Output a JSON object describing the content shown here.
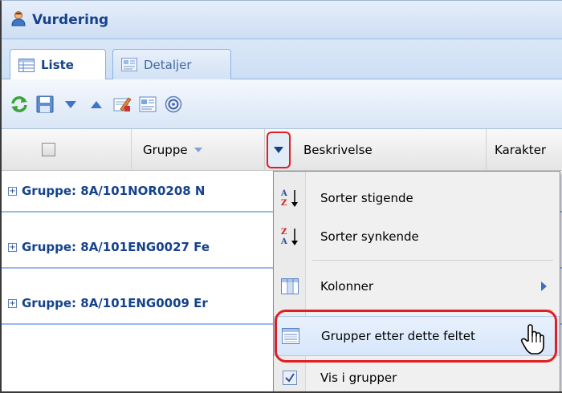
{
  "window": {
    "title": "Vurdering",
    "title_icon": "users-icon"
  },
  "tabs": [
    {
      "label": "Liste",
      "icon": "list-icon",
      "active": true
    },
    {
      "label": "Detaljer",
      "icon": "details-icon",
      "active": false
    }
  ],
  "toolbar": {
    "buttons": [
      "refresh-icon",
      "save-icon",
      "move-down-icon",
      "move-up-icon",
      "edit-icon",
      "layout-icon",
      "help-icon"
    ]
  },
  "grid": {
    "columns": [
      "Gruppe",
      "Beskrivelse",
      "Karakter"
    ],
    "groups": [
      "Gruppe: 8A/101NOR0208 N",
      "Gruppe: 8A/101ENG0027 Fe",
      "Gruppe: 8A/101ENG0009 Er"
    ]
  },
  "menu": {
    "items": [
      {
        "label": "Sorter stigende",
        "icon": "sort-asc-icon"
      },
      {
        "label": "Sorter synkende",
        "icon": "sort-desc-icon"
      },
      {
        "label": "Kolonner",
        "icon": "columns-icon"
      },
      {
        "label": "Grupper etter dette feltet",
        "icon": "group-by-icon"
      },
      {
        "label": "Vis i grupper",
        "icon": "checkbox-checked-icon",
        "checked": true
      }
    ]
  },
  "colors": {
    "accent": "#15428b",
    "highlight": "#e02020"
  }
}
